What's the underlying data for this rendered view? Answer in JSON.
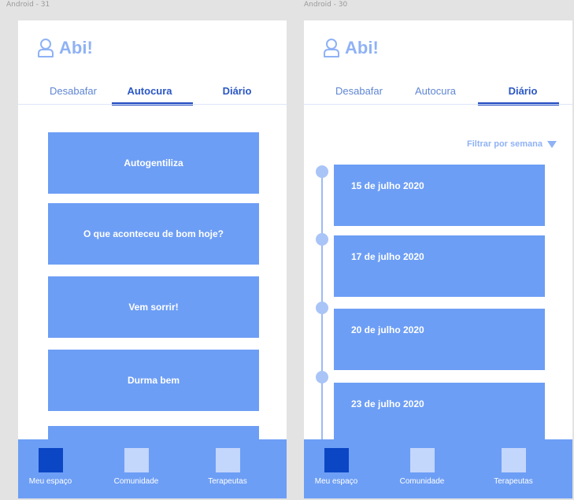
{
  "left_artboard": {
    "label": "Android - 31",
    "brand": {
      "name": "Abi!",
      "icon": "user-outline-icon"
    },
    "tabs": [
      {
        "label": "Desabafar"
      },
      {
        "label": "Autocura"
      },
      {
        "label": "Diário"
      }
    ],
    "active_tab": "Autocura",
    "cards": [
      {
        "label": "Autogentiliza"
      },
      {
        "label": "O que aconteceu de bom hoje?"
      },
      {
        "label": "Vem sorrir!"
      },
      {
        "label": "Durma bem"
      },
      {
        "label": ""
      }
    ],
    "bottom_nav": [
      {
        "label": "Meu espaço",
        "active": true
      },
      {
        "label": "Comunidade",
        "active": false
      },
      {
        "label": "Terapeutas",
        "active": false
      }
    ]
  },
  "right_artboard": {
    "label": "Android - 30",
    "brand": {
      "name": "Abi!",
      "icon": "user-outline-icon"
    },
    "tabs": [
      {
        "label": "Desabafar"
      },
      {
        "label": "Autocura"
      },
      {
        "label": "Diário"
      }
    ],
    "active_tab": "Diário",
    "filter": {
      "label": "Filtrar por semana",
      "icon": "caret-down-icon"
    },
    "entries": [
      {
        "date": "15 de julho 2020"
      },
      {
        "date": "17 de julho 2020"
      },
      {
        "date": "20 de julho 2020"
      },
      {
        "date": "23 de julho 2020"
      }
    ],
    "bottom_nav": [
      {
        "label": "Meu espaço",
        "active": true
      },
      {
        "label": "Comunidade",
        "active": false
      },
      {
        "label": "Terapeutas",
        "active": false
      }
    ]
  },
  "colors": {
    "background": "#e3e3e3",
    "brand": "#8fb2f5",
    "card": "#6d9ef5",
    "tab_active": "#2a56c4",
    "tab_underline": "#1f49c0",
    "nav_active_icon": "#0b46c4",
    "nav_icon": "#c3d6fb"
  }
}
